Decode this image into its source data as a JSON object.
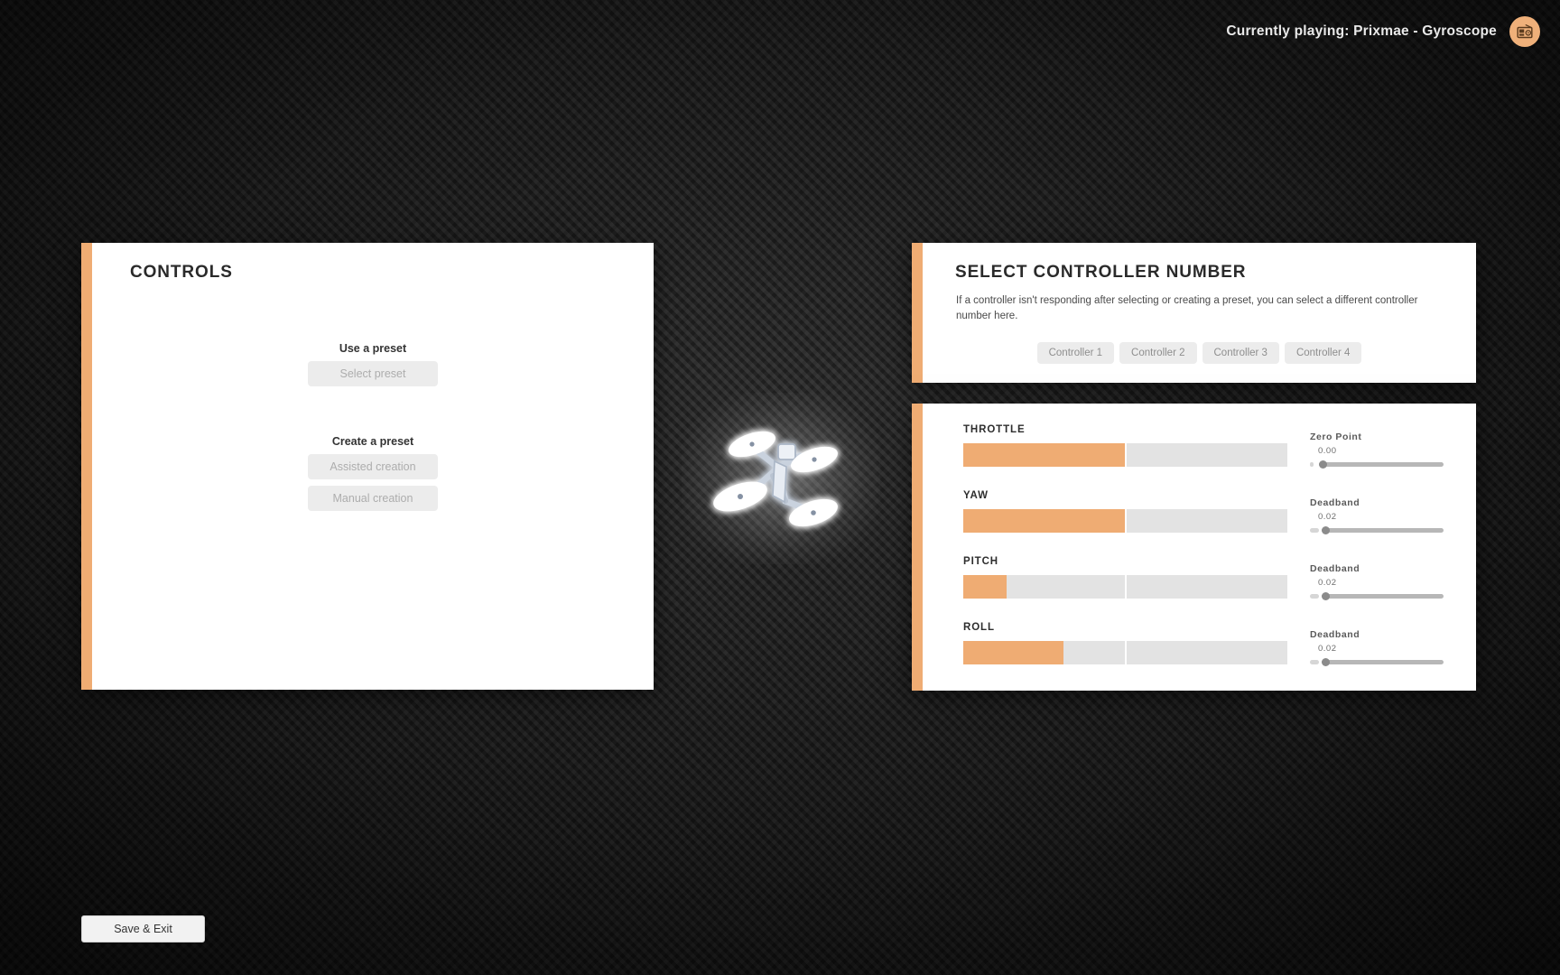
{
  "now_playing": {
    "text": "Currently playing: Prixmae - Gyroscope",
    "badge_icon": "radio-icon",
    "badge_color": "#efb07a"
  },
  "theme": {
    "accent": "#efac73",
    "bar_track": "#e3e3e3",
    "panel_bg": "#ffffff",
    "background": "#242424"
  },
  "controls_panel": {
    "title": "CONTROLS",
    "groups": [
      {
        "heading": "Use a preset",
        "buttons": [
          "Select preset"
        ]
      },
      {
        "heading": "Create a preset",
        "buttons": [
          "Assisted creation",
          "Manual creation"
        ]
      }
    ]
  },
  "controller_panel": {
    "title": "SELECT CONTROLLER NUMBER",
    "description": "If a controller isn't responding after selecting or creating a preset, you can select a different controller number here.",
    "buttons": [
      "Controller 1",
      "Controller 2",
      "Controller 3",
      "Controller 4"
    ]
  },
  "axes_panel": {
    "axes": [
      {
        "label": "THROTTLE",
        "left_fill_pct": 100,
        "right_fill_pct": 0,
        "slider": {
          "name": "Zero Point",
          "value": "0.00",
          "stub_pct": 3,
          "knob_pct": 7
        }
      },
      {
        "label": "YAW",
        "left_fill_pct": 100,
        "right_fill_pct": 0,
        "slider": {
          "name": "Deadband",
          "value": "0.02",
          "stub_pct": 7,
          "knob_pct": 9
        }
      },
      {
        "label": "PITCH",
        "left_fill_pct": 27,
        "right_fill_pct": 0,
        "slider": {
          "name": "Deadband",
          "value": "0.02",
          "stub_pct": 7,
          "knob_pct": 9
        }
      },
      {
        "label": "ROLL",
        "left_fill_pct": 62,
        "right_fill_pct": 0,
        "slider": {
          "name": "Deadband",
          "value": "0.02",
          "stub_pct": 7,
          "knob_pct": 9
        }
      }
    ]
  },
  "footer": {
    "save_exit_label": "Save & Exit"
  },
  "drone": {
    "icon": "quadcopter-drone"
  }
}
